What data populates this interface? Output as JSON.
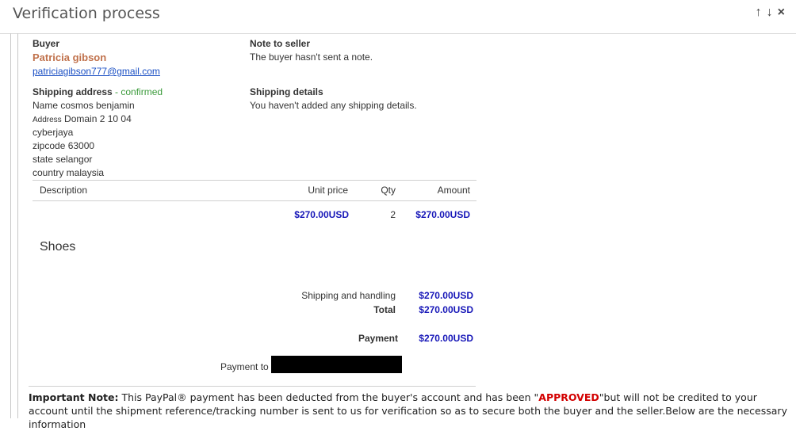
{
  "window": {
    "title": "Verification process"
  },
  "header_icons": [
    {
      "name": "arrow-up-icon",
      "glyph": "↑"
    },
    {
      "name": "arrow-down-icon",
      "glyph": "↓"
    },
    {
      "name": "close-icon",
      "glyph": "×"
    }
  ],
  "buyer": {
    "label": "Buyer",
    "name": "Patricia gibson",
    "email": "patriciagibson777@gmail.com"
  },
  "note_to_seller": {
    "label": "Note to seller",
    "text": "The buyer hasn't sent a note."
  },
  "shipping_address": {
    "label": "Shipping address",
    "status": " - confirmed",
    "name_label": "Name",
    "name_value": "cosmos benjamin",
    "address_label": "Address",
    "address_value": "Domain 2 10 04",
    "lines": [
      "cyberjaya",
      "zipcode 63000",
      "state selangor",
      "country malaysia"
    ]
  },
  "shipping_details": {
    "label": "Shipping details",
    "text": "You haven't added any shipping details."
  },
  "table": {
    "headers": {
      "description": "Description",
      "unit_price": "Unit price",
      "qty": "Qty",
      "amount": "Amount"
    },
    "row": {
      "unit_price": "$270.00USD",
      "qty": "2",
      "amount": "$270.00USD"
    }
  },
  "item_title": "Shoes",
  "summary": {
    "shipping_label": "Shipping and handling",
    "shipping_value": "$270.00USD",
    "total_label": "Total",
    "total_value": "$270.00USD",
    "payment_label": "Payment",
    "payment_value": "$270.00USD",
    "payment_to_label": "Payment to :"
  },
  "important_note": {
    "label": "Important Note:",
    "text_before": " This PayPal® payment has been deducted from the buyer's account and has  been \"",
    "approved": "APPROVED",
    "text_after": "\"but will not be credited to your account until the shipment reference/tracking  number is sent to us for verification so as to secure both the buyer and the seller.Below are the necessary information"
  },
  "colors": {
    "buyer_name": "#c0714b",
    "link": "#1a4fc4",
    "confirmed": "#3a9a3a",
    "amount_blue": "#1717b8",
    "approved_red": "#d30000"
  }
}
